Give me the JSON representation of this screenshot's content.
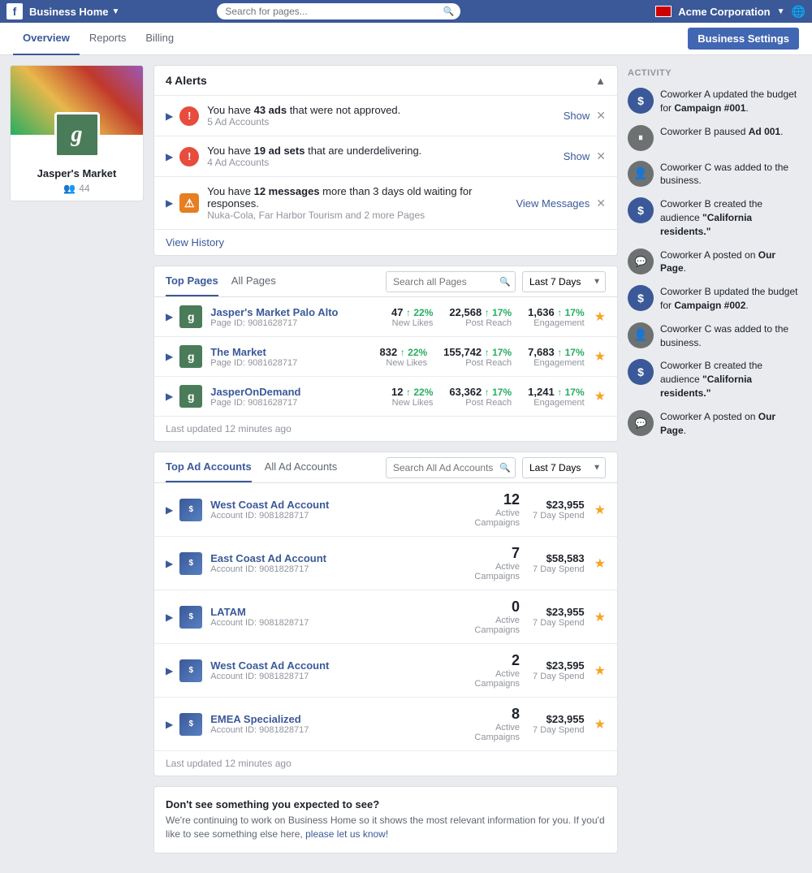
{
  "topNav": {
    "appName": "Business Home",
    "searchPlaceholder": "Search for pages...",
    "acmeName": "Acme Corporation"
  },
  "subNav": {
    "tabs": [
      "Overview",
      "Reports",
      "Billing"
    ],
    "activeTab": "Overview",
    "settingsBtn": "Business Settings"
  },
  "profile": {
    "name": "Jasper's Market",
    "followers": "44",
    "avatarLetter": "g"
  },
  "alerts": {
    "title": "4 Alerts",
    "items": [
      {
        "type": "red",
        "mainText": "You have ",
        "boldText": "43 ads",
        "restText": " that were not approved.",
        "subText": "5 Ad Accounts",
        "action": "Show"
      },
      {
        "type": "red",
        "mainText": "You have ",
        "boldText": "19 ad sets",
        "restText": " that are underdelivering.",
        "subText": "4 Ad Accounts",
        "action": "Show"
      },
      {
        "type": "orange",
        "mainText": "You have ",
        "boldText": "12 messages",
        "restText": " more than 3 days old waiting for responses.",
        "subText": "Nuka-Cola, Far Harbor Tourism and 2 more Pages",
        "action": "View Messages"
      }
    ],
    "viewHistory": "View History"
  },
  "topPages": {
    "tabs": [
      "Top Pages",
      "All Pages"
    ],
    "activeTab": "Top Pages",
    "searchPlaceholder": "Search all Pages",
    "dateFilter": "Last 7 Days",
    "columns": [
      "New Likes",
      "Post Reach",
      "Engagement"
    ],
    "pages": [
      {
        "name": "Jasper's Market Palo Alto",
        "id": "Page ID: 9081628717",
        "newLikes": "47",
        "newLikesPct": "+22%",
        "postReach": "22,568",
        "postReachPct": "+17%",
        "engagement": "1,636",
        "engagementPct": "+17%"
      },
      {
        "name": "The Market",
        "id": "Page ID: 9081628717",
        "newLikes": "832",
        "newLikesPct": "+22%",
        "postReach": "155,742",
        "postReachPct": "+17%",
        "engagement": "7,683",
        "engagementPct": "+17%"
      },
      {
        "name": "JasperOnDemand",
        "id": "Page ID: 9081628717",
        "newLikes": "12",
        "newLikesPct": "+22%",
        "postReach": "63,362",
        "postReachPct": "+17%",
        "engagement": "1,241",
        "engagementPct": "+17%"
      }
    ],
    "lastUpdated": "Last updated 12 minutes ago"
  },
  "adAccounts": {
    "tabs": [
      "Top Ad Accounts",
      "All Ad Accounts"
    ],
    "activeTab": "Top Ad Accounts",
    "searchPlaceholder": "Search All Ad Accounts",
    "dateFilter": "Last 7 Days",
    "accounts": [
      {
        "name": "West Coast Ad Account",
        "id": "Account ID: 9081828717",
        "campaigns": "12",
        "spend": "$23,955"
      },
      {
        "name": "East Coast Ad Account",
        "id": "Account ID: 9081828717",
        "campaigns": "7",
        "spend": "$58,583"
      },
      {
        "name": "LATAM",
        "id": "Account ID: 9081828717",
        "campaigns": "0",
        "spend": "$23,955"
      },
      {
        "name": "West Coast Ad Account",
        "id": "Account ID: 9081828717",
        "campaigns": "2",
        "spend": "$23,595"
      },
      {
        "name": "EMEA Specialized",
        "id": "Account ID: 9081828717",
        "campaigns": "8",
        "spend": "$23,955"
      }
    ],
    "campaignsLabel": "Active\nCampaigns",
    "spendLabel": "7 Day Spend",
    "lastUpdated": "Last updated 12 minutes ago"
  },
  "dontSee": {
    "title": "Don't see something you expected to see?",
    "text": "We're continuing to work on Business Home so it shows the most relevant information for you. If you'd like to see something else here, ",
    "linkText": "please let us know!",
    "afterLink": ""
  },
  "activity": {
    "header": "ACTIVITY",
    "items": [
      {
        "type": "dollar",
        "text": "Coworker A updated the budget for ",
        "boldText": "Campaign #001",
        "afterBold": "."
      },
      {
        "type": "pause",
        "text": "Coworker B paused ",
        "boldText": "Ad 001",
        "afterBold": "."
      },
      {
        "type": "person",
        "text": "Coworker C was added to the business.",
        "boldText": "",
        "afterBold": ""
      },
      {
        "type": "dollar",
        "text": "Coworker B created the audience ",
        "boldText": "\"California residents.\"",
        "afterBold": ""
      },
      {
        "type": "chat",
        "text": "Coworker A posted on ",
        "boldText": "Our Page",
        "afterBold": "."
      },
      {
        "type": "dollar",
        "text": "Coworker B updated the budget for ",
        "boldText": "Campaign #002",
        "afterBold": "."
      },
      {
        "type": "person",
        "text": "Coworker C was added to the business.",
        "boldText": "",
        "afterBold": ""
      },
      {
        "type": "dollar",
        "text": "Coworker B created the audience ",
        "boldText": "\"California residents.\"",
        "afterBold": ""
      },
      {
        "type": "chat",
        "text": "Coworker A posted on ",
        "boldText": "Our Page",
        "afterBold": "."
      }
    ]
  }
}
